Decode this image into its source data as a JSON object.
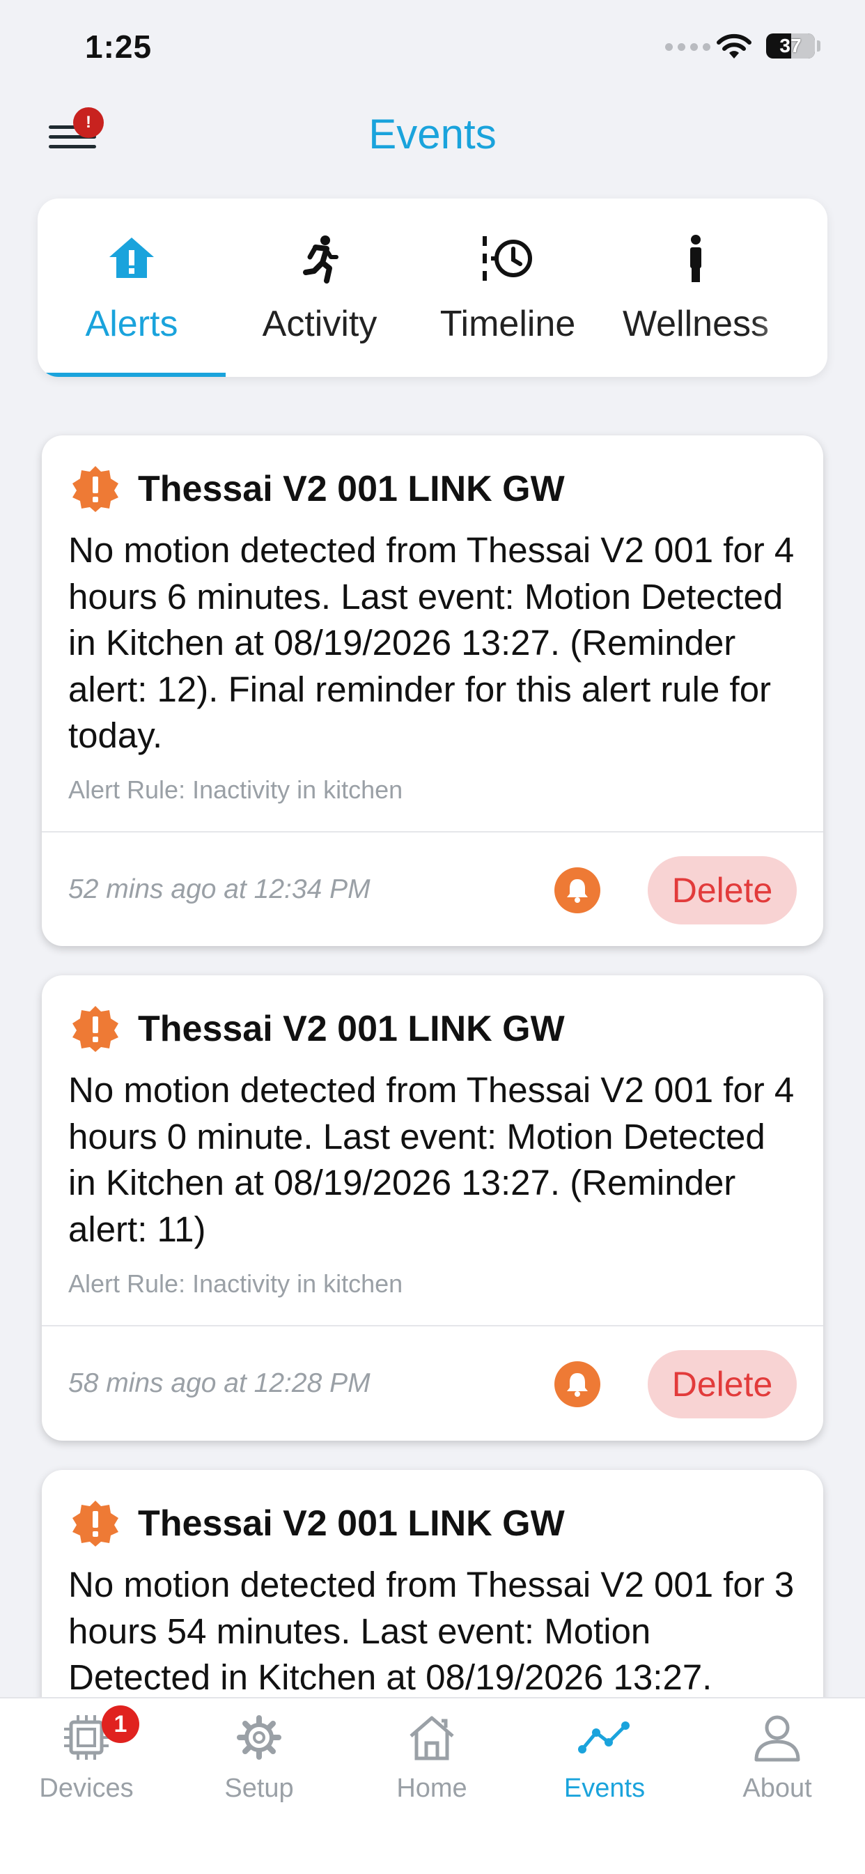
{
  "status_bar": {
    "time": "1:25",
    "battery": "37"
  },
  "header": {
    "title": "Events",
    "menu_badge": "!"
  },
  "tabs": [
    {
      "label": "Alerts",
      "icon": "home-alert-icon",
      "active": true
    },
    {
      "label": "Activity",
      "icon": "running-person-icon",
      "active": false
    },
    {
      "label": "Timeline",
      "icon": "timeline-clock-icon",
      "active": false
    },
    {
      "label": "Wellness",
      "icon": "person-icon",
      "active": false
    }
  ],
  "alerts": [
    {
      "title": "Thessai V2 001 LINK GW",
      "message": "No motion detected from Thessai V2 001 for 4 hours 6 minutes. Last event: Motion Detected in Kitchen at 08/19/2026 13:27. (Reminder alert: 12). Final reminder for this alert rule for today.",
      "rule": "Alert Rule: Inactivity in kitchen",
      "time": "52 mins ago at 12:34 PM",
      "delete_label": "Delete"
    },
    {
      "title": "Thessai V2 001 LINK GW",
      "message": "No motion detected from Thessai V2 001 for 4 hours 0 minute. Last event: Motion Detected in Kitchen at 08/19/2026 13:27. (Reminder alert: 11)",
      "rule": "Alert Rule: Inactivity in kitchen",
      "time": "58 mins ago at 12:28 PM",
      "delete_label": "Delete"
    },
    {
      "title": "Thessai V2 001 LINK GW",
      "message": "No motion detected from Thessai V2 001 for 3 hours 54 minutes. Last event: Motion Detected in Kitchen at 08/19/2026 13:27."
    }
  ],
  "bottom_nav": [
    {
      "label": "Devices",
      "icon": "chip-icon",
      "badge": "1",
      "active": false
    },
    {
      "label": "Setup",
      "icon": "gear-icon",
      "active": false
    },
    {
      "label": "Home",
      "icon": "house-icon",
      "active": false
    },
    {
      "label": "Events",
      "icon": "line-chart-icon",
      "active": true
    },
    {
      "label": "About",
      "icon": "user-icon",
      "active": false
    }
  ],
  "colors": {
    "accent": "#1aa3dc",
    "alert": "#ee7a35",
    "delete": "#e23b3b",
    "badge": "#e0221f"
  }
}
